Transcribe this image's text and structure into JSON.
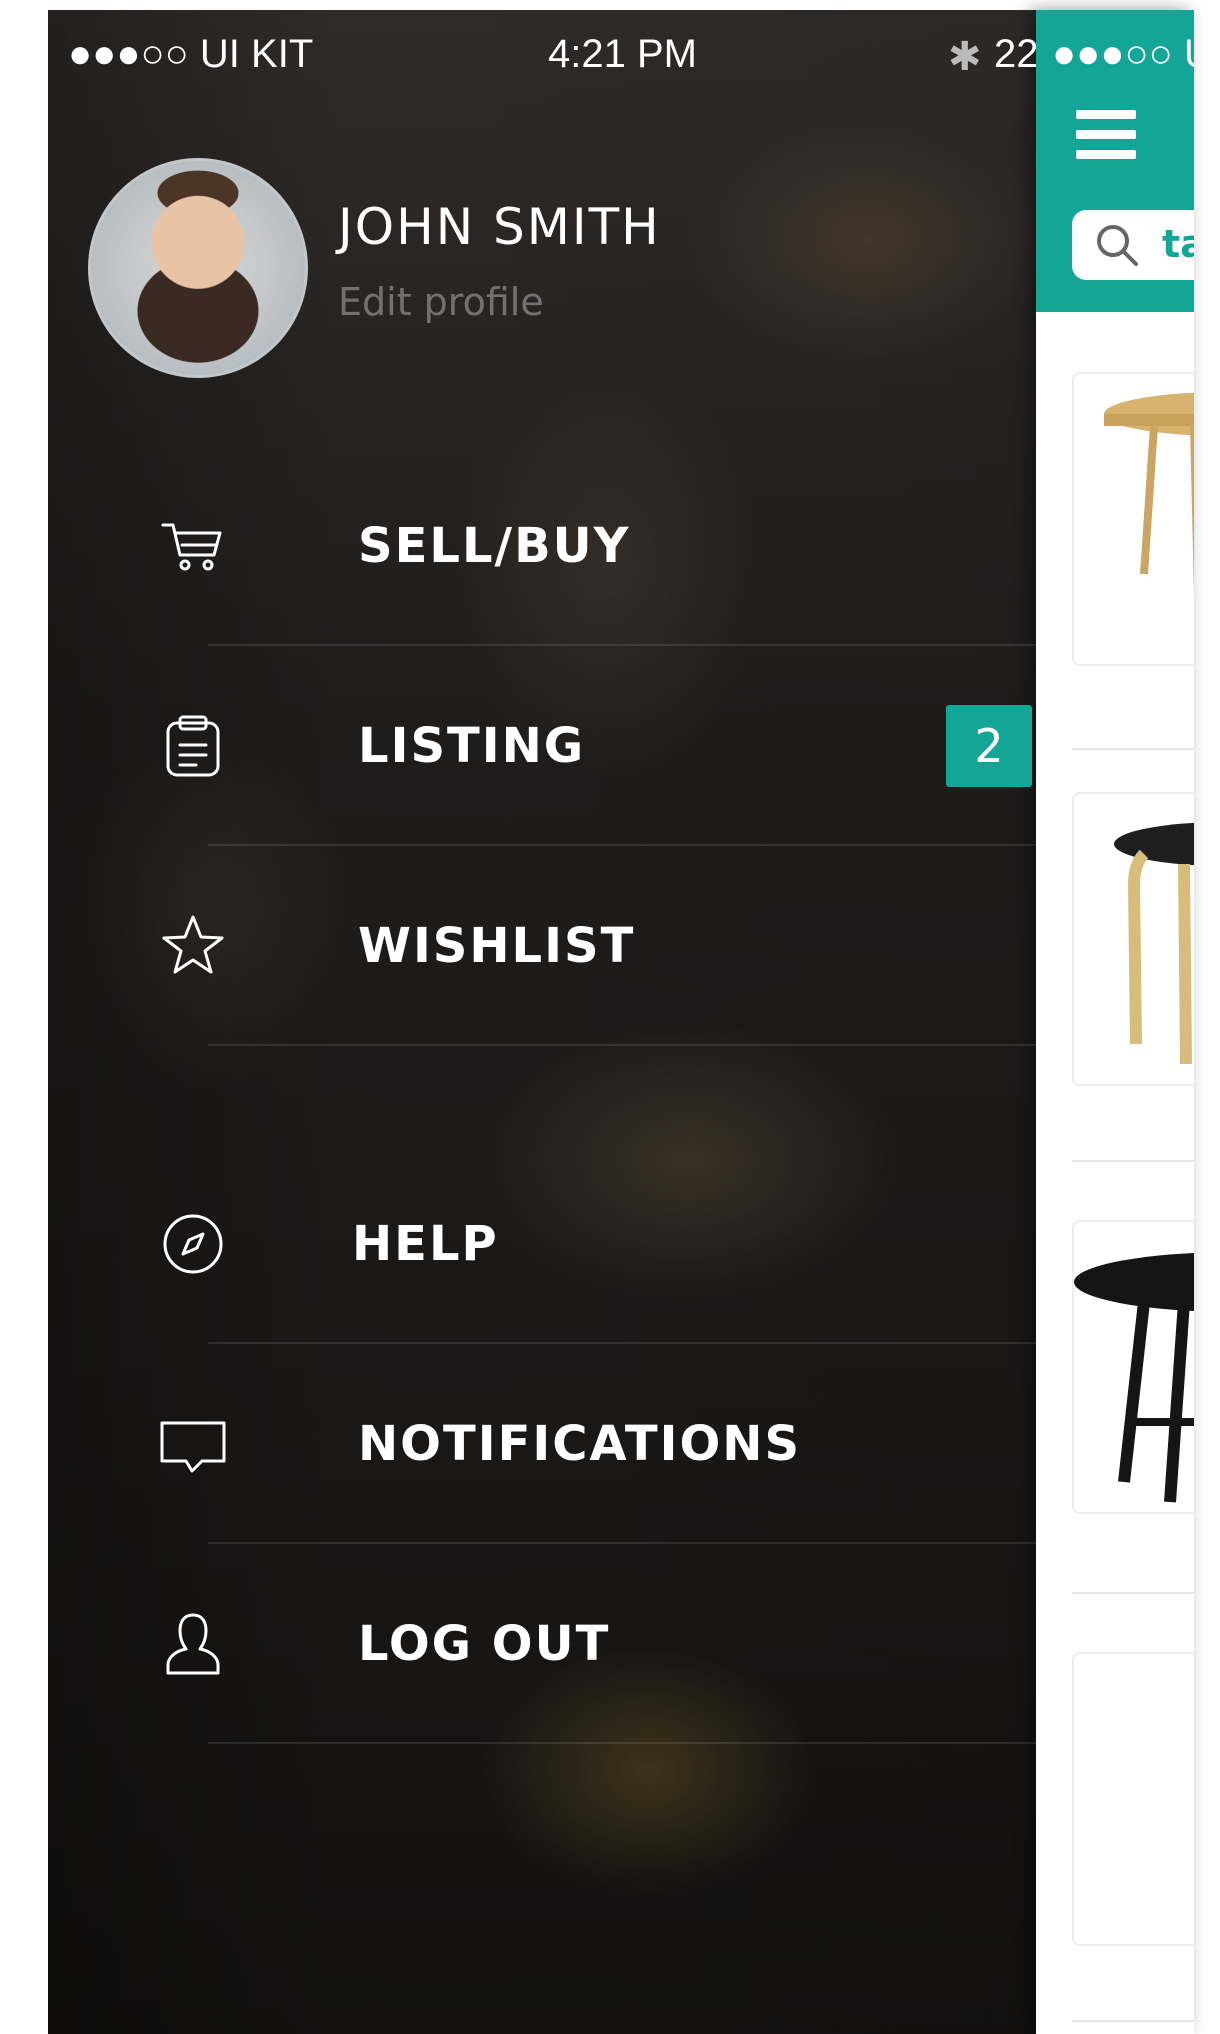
{
  "status_bar": {
    "carrier": "●●●○○ UI KIT",
    "time": "4:21 PM",
    "battery": "22"
  },
  "profile": {
    "name": "JOHN SMITH",
    "edit_label": "Edit profile"
  },
  "menu": [
    {
      "label": "SELL/BUY",
      "icon": "cart-icon"
    },
    {
      "label": "LISTING",
      "icon": "clipboard-icon",
      "badge": "2"
    },
    {
      "label": "WISHLIST",
      "icon": "star-icon"
    },
    {
      "label": "HELP",
      "icon": "compass-icon"
    },
    {
      "label": "NOTIFICATIONS",
      "icon": "chat-bubble-icon"
    },
    {
      "label": "LOG OUT",
      "icon": "user-icon"
    }
  ],
  "main_screen": {
    "status": "●●●○○ U",
    "search_text": "ta"
  },
  "colors": {
    "accent": "#13a596",
    "drawer_bg": "#1f1d1c"
  }
}
